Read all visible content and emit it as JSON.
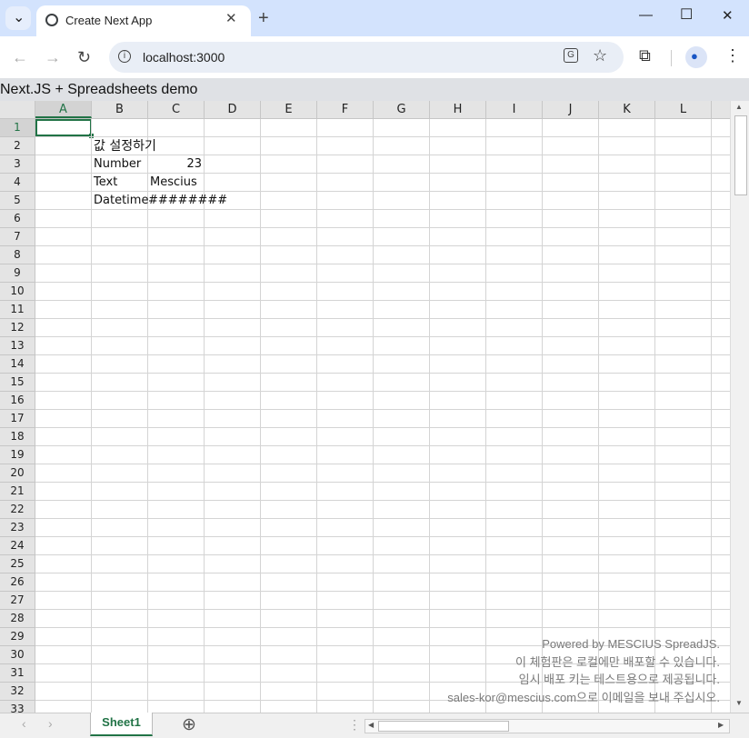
{
  "browser": {
    "tab_title": "Create Next App",
    "close_tab": "✕",
    "new_tab": "+",
    "url": "localhost:3000",
    "info": "i",
    "minimize": "—",
    "maximize": "☐",
    "close_window": "✕",
    "back": "←",
    "forward": "→",
    "reload": "↻",
    "translate_icon": "translate-icon",
    "star_icon": "☆",
    "extensions_icon": "⧉",
    "profile_icon": "●",
    "menu_icon": "⋮",
    "tab_menu": "⌄"
  },
  "app": {
    "title": "Next.JS + Spreadsheets demo"
  },
  "sheet": {
    "columns": [
      "A",
      "B",
      "C",
      "D",
      "E",
      "F",
      "G",
      "H",
      "I",
      "J",
      "K",
      "L"
    ],
    "rows": [
      "1",
      "2",
      "3",
      "4",
      "5",
      "6",
      "7",
      "8",
      "9",
      "10",
      "11",
      "12",
      "13",
      "14",
      "15",
      "16",
      "17",
      "18",
      "19",
      "20",
      "21",
      "22",
      "23",
      "24",
      "25",
      "26",
      "27",
      "28",
      "29",
      "30",
      "31",
      "32",
      "33"
    ],
    "selected_cell": "A1",
    "cells": {
      "B2": "값 설정하기",
      "B3": "Number",
      "C3": "23",
      "B4": "Text",
      "C4": "Mescius",
      "B5": "Datetime",
      "C5": "########"
    },
    "watermark": [
      "Powered by MESCIUS SpreadJS.",
      "이 체험판은 로컬에만 배포할 수 있습니다.",
      "임시 배포 키는 테스트용으로 제공됩니다.",
      "sales-kor@mescius.com으로 이메일을 보내 주십시오."
    ],
    "sheet_tab": "Sheet1",
    "add_sheet": "⊕",
    "nav_prev": "‹",
    "nav_next": "›",
    "split_handle": "⋮"
  },
  "colors": {
    "accent": "#217346",
    "tabstrip": "#d3e3fd",
    "omnibox": "#e9eef6"
  }
}
